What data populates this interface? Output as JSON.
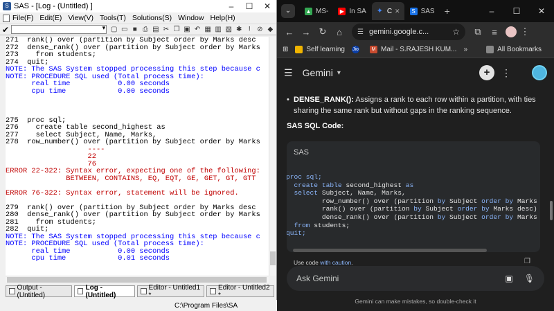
{
  "sas": {
    "title": "SAS - [Log - (Untitled) ]",
    "window_controls": [
      "–",
      "☐",
      "✕"
    ],
    "menu": [
      "File(F)",
      "Edit(E)",
      "View(V)",
      "Tools(T)",
      "Solutions(S)",
      "Window",
      "Help(H)"
    ],
    "command_box_value": "",
    "log_lines": [
      {
        "t": "271  rank() over (partition by Subject order by Marks desc",
        "c": "black"
      },
      {
        "t": "272  dense_rank() over (partition by Subject order by Marks",
        "c": "black"
      },
      {
        "t": "273    from students;",
        "c": "black"
      },
      {
        "t": "274  quit;",
        "c": "black"
      },
      {
        "t": "NOTE: The SAS System stopped processing this step because c",
        "c": "blue"
      },
      {
        "t": "NOTE: PROCEDURE SQL used (Total process time):",
        "c": "blue"
      },
      {
        "t": "      real time           0.00 seconds",
        "c": "blue"
      },
      {
        "t": "      cpu time            0.00 seconds",
        "c": "blue"
      },
      {
        "t": "",
        "c": "black"
      },
      {
        "t": "",
        "c": "black"
      },
      {
        "t": "",
        "c": "black"
      },
      {
        "t": "275  proc sql;",
        "c": "black"
      },
      {
        "t": "276    create table second_highest as",
        "c": "black"
      },
      {
        "t": "277    select Subject, Name, Marks,",
        "c": "black"
      },
      {
        "t": "278  row_number() over (partition by Subject order by Marks",
        "c": "black"
      },
      {
        "t": "                   ----",
        "c": "red"
      },
      {
        "t": "                   22",
        "c": "red"
      },
      {
        "t": "                   76",
        "c": "red"
      },
      {
        "t": "ERROR 22-322: Syntax error, expecting one of the following:",
        "c": "red"
      },
      {
        "t": "              BETWEEN, CONTAINS, EQ, EQT, GE, GET, GT, GTT",
        "c": "red"
      },
      {
        "t": "",
        "c": "black"
      },
      {
        "t": "ERROR 76-322: Syntax error, statement will be ignored.",
        "c": "red"
      },
      {
        "t": "",
        "c": "black"
      },
      {
        "t": "279  rank() over (partition by Subject order by Marks desc",
        "c": "black"
      },
      {
        "t": "280  dense_rank() over (partition by Subject order by Marks",
        "c": "black"
      },
      {
        "t": "281    from students;",
        "c": "black"
      },
      {
        "t": "282  quit;",
        "c": "black"
      },
      {
        "t": "NOTE: The SAS System stopped processing this step because c",
        "c": "blue"
      },
      {
        "t": "NOTE: PROCEDURE SQL used (Total process time):",
        "c": "blue"
      },
      {
        "t": "      real time           0.00 seconds",
        "c": "blue"
      },
      {
        "t": "      cpu time            0.01 seconds",
        "c": "blue"
      }
    ],
    "tabs": [
      "Output - (Untitled)",
      "Log - (Untitled)",
      "Editor - Untitled1 *",
      "Editor - Untitled2 *"
    ],
    "active_tab": 1,
    "status_path": "C:\\Program Files\\SA"
  },
  "chrome": {
    "tabs": [
      {
        "label": "MS-",
        "favicon": "drive-icon",
        "color": "#34a853"
      },
      {
        "label": "In SA",
        "favicon": "youtube-icon",
        "color": "#ff0000"
      },
      {
        "label": "C",
        "favicon": "gemini-icon",
        "color": "#4285f4"
      },
      {
        "label": "SAS",
        "favicon": "sas-icon",
        "color": "#1a73e8"
      }
    ],
    "active_tab": 2,
    "url": "gemini.google.c...",
    "bookmarks": [
      {
        "label": "Self learning",
        "icon": "folder-icon",
        "color": "#f0b400"
      },
      {
        "label": "",
        "icon": "jio-icon",
        "color": "#0a3ea8"
      },
      {
        "label": "Mail - S.RAJESH KUM...",
        "icon": "outlook-icon",
        "color": "#c84b2f"
      }
    ],
    "all_bookmarks": "All Bookmarks"
  },
  "gemini": {
    "title": "Gemini",
    "bullet_term": "DENSE_RANK():",
    "bullet_text": " Assigns a rank to each row within a partition, with ties sharing the same rank but without gaps in the ranking sequence.",
    "code_heading": "SAS SQL Code:",
    "code_lang": "SAS",
    "code_lines": [
      [
        [
          "proc sql;",
          "b"
        ]
      ],
      [
        [
          "  ",
          "d"
        ],
        [
          "create table",
          "b"
        ],
        [
          " second_highest ",
          "d"
        ],
        [
          "as",
          "b"
        ]
      ],
      [
        [
          "  ",
          "d"
        ],
        [
          "select",
          "b"
        ],
        [
          " Subject, Name, Marks,",
          "d"
        ]
      ],
      [
        [
          "         row_number() over (partition ",
          "d"
        ],
        [
          "by",
          "b"
        ],
        [
          " Subject ",
          "d"
        ],
        [
          "order by",
          "b"
        ],
        [
          " Marks desc",
          "d"
        ]
      ],
      [
        [
          "         rank() over (partition ",
          "d"
        ],
        [
          "by",
          "b"
        ],
        [
          " Subject ",
          "d"
        ],
        [
          "order by",
          "b"
        ],
        [
          " Marks desc) ",
          "d"
        ],
        [
          "as",
          "b"
        ],
        [
          " r",
          "d"
        ]
      ],
      [
        [
          "         dense_rank() over (partition ",
          "d"
        ],
        [
          "by",
          "b"
        ],
        [
          " Subject ",
          "d"
        ],
        [
          "order by",
          "b"
        ],
        [
          " Marks desc",
          "d"
        ]
      ],
      [
        [
          "  ",
          "d"
        ],
        [
          "from",
          "b"
        ],
        [
          " students;",
          "d"
        ]
      ],
      [
        [
          "quit;",
          "b"
        ]
      ]
    ],
    "caution_prefix": "Use code ",
    "caution_link": "with caution",
    "caution_suffix": ".",
    "input_placeholder": "Ask Gemini",
    "disclaimer": "Gemini can make mistakes, so double-check it"
  }
}
